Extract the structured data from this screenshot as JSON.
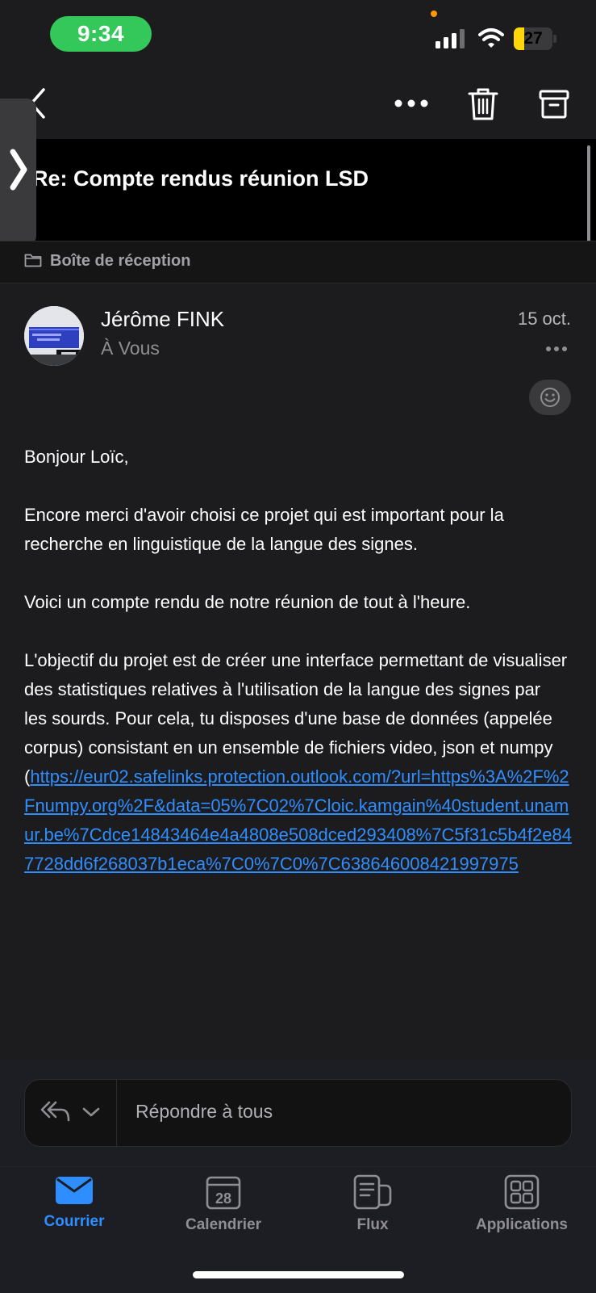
{
  "status_bar": {
    "time": "9:34",
    "battery": "27",
    "battery_level": 0.27
  },
  "nav": {
    "back_icon": "chevron-left-icon",
    "more_icon": "more-horizontal-icon",
    "delete_icon": "trash-icon",
    "archive_icon": "archive-icon"
  },
  "email": {
    "subject": "Re: Compte rendus réunion LSD",
    "folder": "Boîte de réception",
    "sender": "Jérôme FINK",
    "recipient": "À Vous",
    "date": "15 oct.",
    "greeting": "Bonjour Loïc,",
    "p1_line1": "Encore merci d'avoir choisi ce projet qui est important pour la",
    "p1_line2": "recherche en linguistique de la langue des signes.",
    "p2": "Voici un compte rendu de notre réunion de tout à l'heure.",
    "p3_line1": "L'objectif du projet est de créer une interface permettant de visualiser",
    "p3_line2": "des statistiques relatives à l'utilisation de la langue des signes par",
    "p3_line3": "les sourds. Pour cela, tu disposes d'une base de données (appelée",
    "p3_line4": "corpus) consistant en un ensemble de fichiers video, json et numpy",
    "p3_open_paren": "(",
    "link": "https://eur02.safelinks.protection.outlook.com/?url=https%3A%2F%2Fnumpy.org%2F&data=05%7C02%7Cloic.kamgain%40student.unamur.be%7Cdce14843464e4a4808e508dced293408%7C5f31c5b4f2e847728dd6f268037b1eca%7C0%7C0%7C638646008421997975"
  },
  "reply": {
    "placeholder": "Répondre à tous"
  },
  "tabs": [
    {
      "label": "Courrier",
      "icon": "mail-icon",
      "active": true
    },
    {
      "label": "Calendrier",
      "icon": "calendar-icon",
      "day": "28",
      "active": false
    },
    {
      "label": "Flux",
      "icon": "feed-icon",
      "active": false
    },
    {
      "label": "Applications",
      "icon": "apps-grid-icon",
      "active": false
    }
  ],
  "colors": {
    "accent": "#2f8eff",
    "time_pill": "#34c759",
    "battery": "#ffd60a"
  }
}
